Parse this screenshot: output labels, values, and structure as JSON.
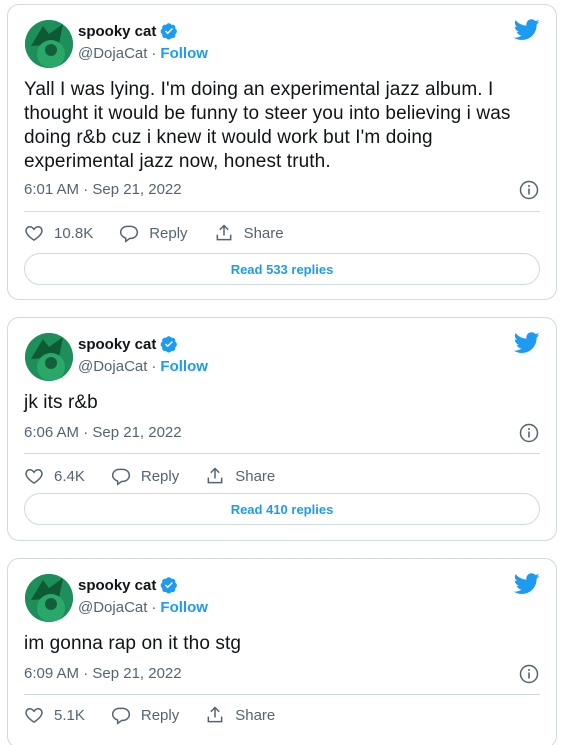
{
  "tweets": [
    {
      "display_name": "spooky cat",
      "handle": "@DojaCat",
      "separator": "·",
      "follow_label": "Follow",
      "text": "Yall I was lying. I'm doing an experimental jazz album. I thought it would be funny to steer you into believing i was doing r&b cuz i knew it would work but I'm doing experimental jazz now, honest truth.",
      "timestamp": "6:01 AM · Sep 21, 2022",
      "likes": "10.8K",
      "reply_label": "Reply",
      "share_label": "Share",
      "read_replies": "Read 533 replies"
    },
    {
      "display_name": "spooky cat",
      "handle": "@DojaCat",
      "separator": "·",
      "follow_label": "Follow",
      "text": "jk its r&b",
      "timestamp": "6:06 AM · Sep 21, 2022",
      "likes": "6.4K",
      "reply_label": "Reply",
      "share_label": "Share",
      "read_replies": "Read 410 replies"
    },
    {
      "display_name": "spooky cat",
      "handle": "@DojaCat",
      "separator": "·",
      "follow_label": "Follow",
      "text": "im gonna rap on it tho stg",
      "timestamp": "6:09 AM · Sep 21, 2022",
      "likes": "5.1K",
      "reply_label": "Reply",
      "share_label": "Share"
    }
  ],
  "icons": {
    "brand": "twitter-bird-icon",
    "verified": "verified-badge-icon",
    "info": "info-icon",
    "like": "heart-icon",
    "reply": "speech-bubble-icon",
    "share": "share-upload-icon"
  },
  "colors": {
    "brand_blue": "#1d9bf0",
    "text_primary": "#0f1419",
    "text_secondary": "#536471",
    "border": "#cfd9de",
    "avatar_green": "#1e8f5a"
  }
}
